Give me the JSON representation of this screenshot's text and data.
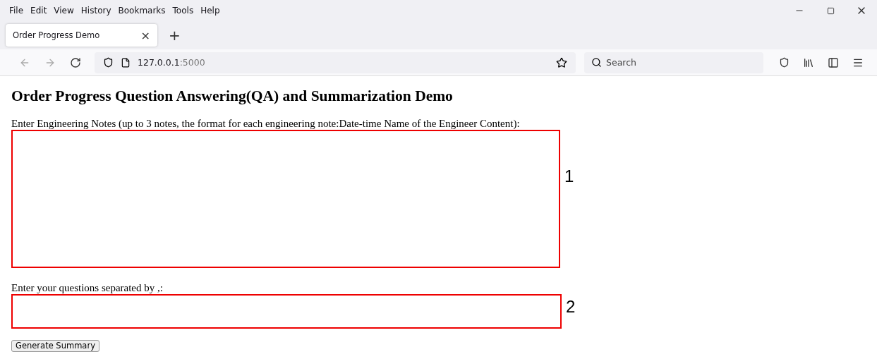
{
  "menu_bar": {
    "items": [
      "File",
      "Edit",
      "View",
      "History",
      "Bookmarks",
      "Tools",
      "Help"
    ]
  },
  "tabs": [
    {
      "label": "Order Progress Demo",
      "selected": true,
      "close": "×"
    }
  ],
  "new_tab": "+",
  "address_bar": {
    "host": "127.0.0.1",
    "port": ":5000"
  },
  "search": {
    "placeholder": "Search"
  },
  "page": {
    "heading": "Order Progress Question Answering(QA) and Summarization Demo",
    "notes_label": "Enter Engineering Notes (up to 3 notes, the format for each engineering note:Date-time Name of the Engineer Content):",
    "notes_marker": "1",
    "questions_label": "Enter your questions separated by ,:",
    "questions_marker": "2",
    "button": "Generate Summary"
  }
}
